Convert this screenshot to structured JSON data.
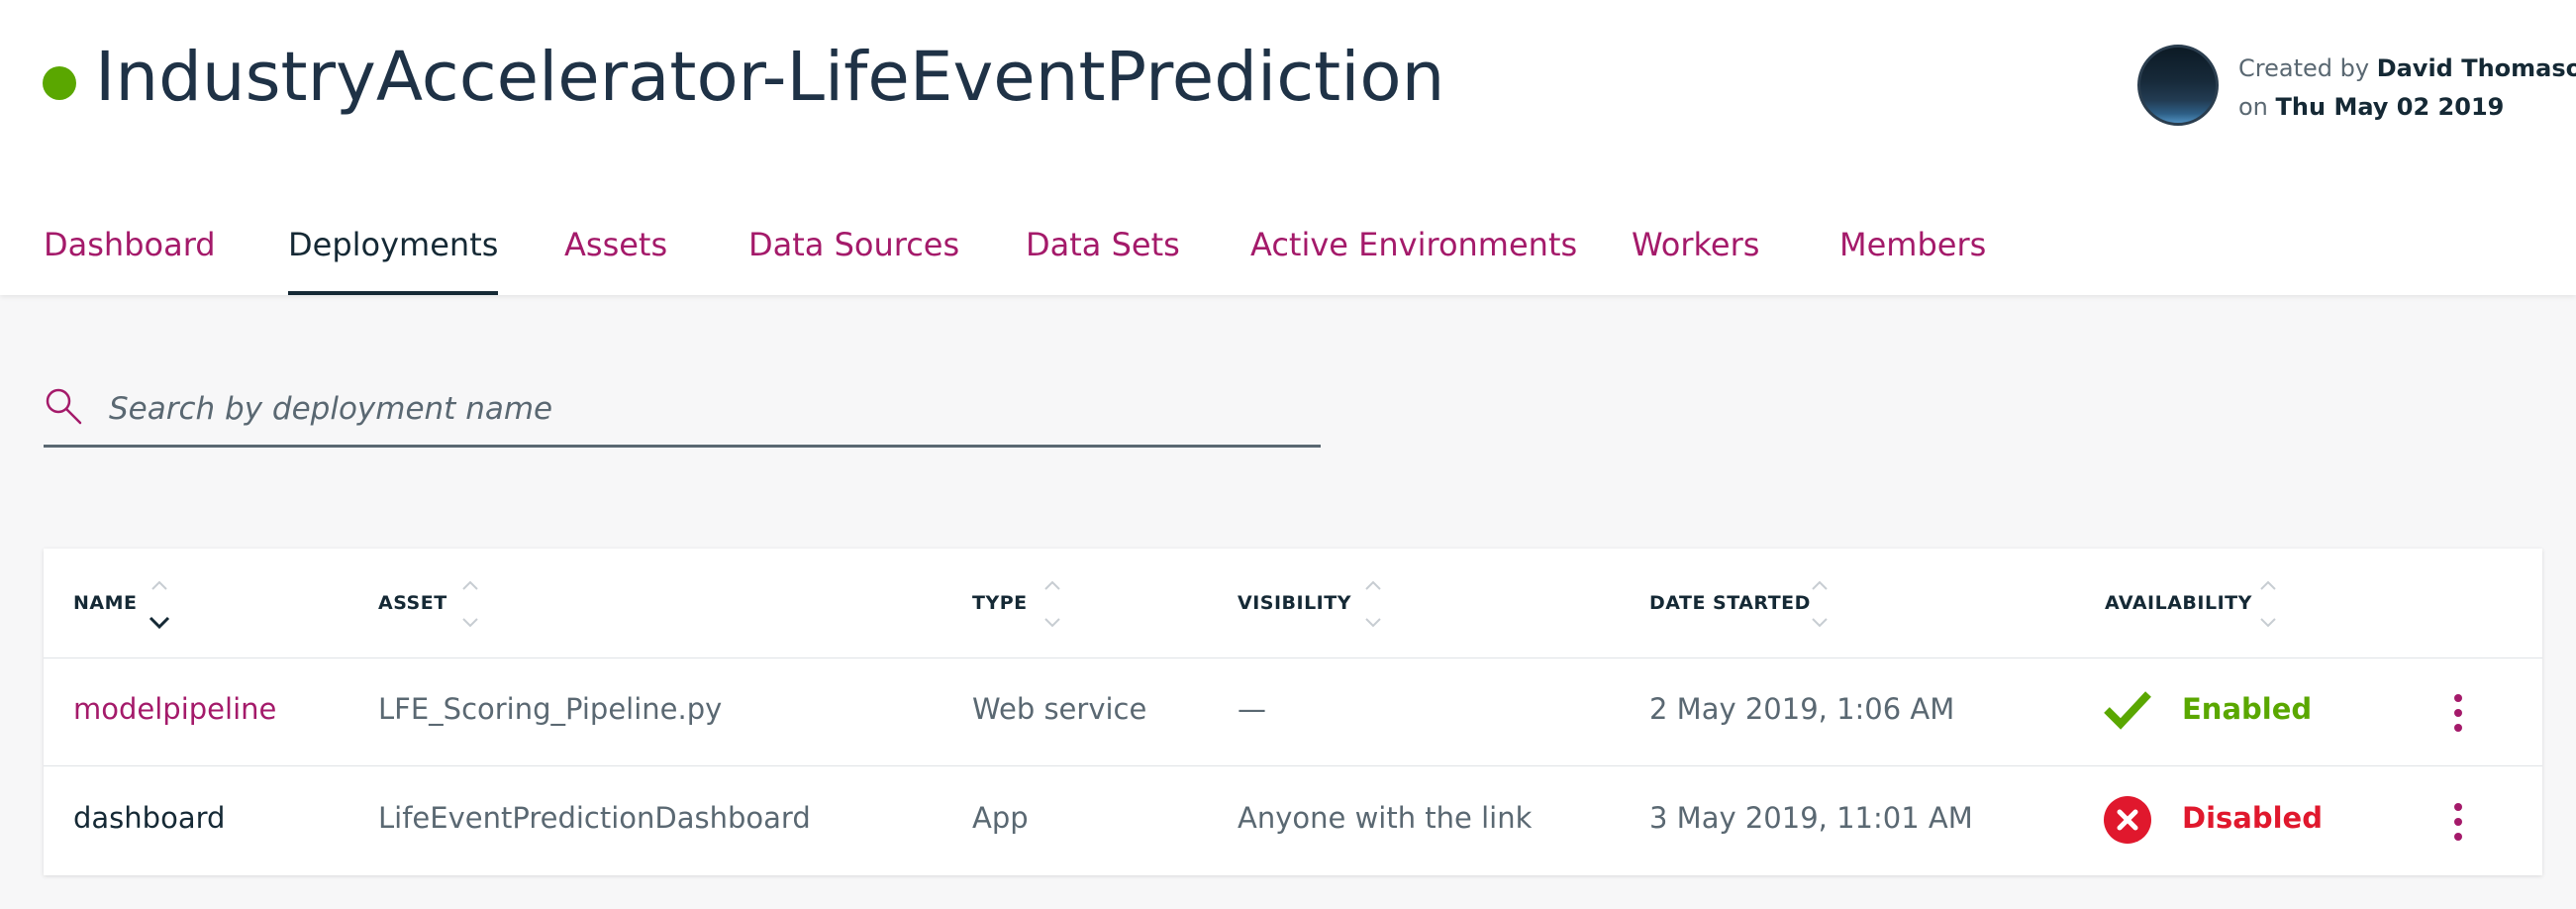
{
  "project": {
    "title": "IndustryAccelerator-LifeEventPrediction",
    "status_color": "#5aa700",
    "created_by_label": "Created by",
    "created_by_name": "David Thomason",
    "created_on_label": "on",
    "created_on_date": "Thu May 02 2019"
  },
  "tabs": [
    {
      "label": "Dashboard",
      "active": false
    },
    {
      "label": "Deployments",
      "active": true
    },
    {
      "label": "Assets",
      "active": false
    },
    {
      "label": "Data Sources",
      "active": false
    },
    {
      "label": "Data Sets",
      "active": false
    },
    {
      "label": "Active Environments",
      "active": false
    },
    {
      "label": "Workers",
      "active": false
    },
    {
      "label": "Members",
      "active": false
    }
  ],
  "search": {
    "placeholder": "Search by deployment name",
    "value": "",
    "icon": "search-icon"
  },
  "table": {
    "columns": [
      "NAME",
      "ASSET",
      "TYPE",
      "VISIBILITY",
      "DATE STARTED",
      "AVAILABILITY"
    ],
    "sorted_column": "NAME",
    "sort_direction": "descending",
    "rows": [
      {
        "name": "modelpipeline",
        "asset": "LFE_Scoring_Pipeline.py",
        "type": "Web service",
        "visibility": "—",
        "date_started": "2 May 2019, 1:06 AM",
        "availability": "Enabled",
        "availability_icon": "checkmark-icon"
      },
      {
        "name": "dashboard",
        "asset": "LifeEventPredictionDashboard",
        "type": "App",
        "visibility": "Anyone with the link",
        "date_started": "3 May 2019, 11:01 AM",
        "availability": "Disabled",
        "availability_icon": "error-circle-icon"
      }
    ]
  },
  "colors": {
    "accent": "#a41a6a",
    "text": "#152935",
    "enabled": "#5aa700",
    "disabled": "#e0182d"
  }
}
